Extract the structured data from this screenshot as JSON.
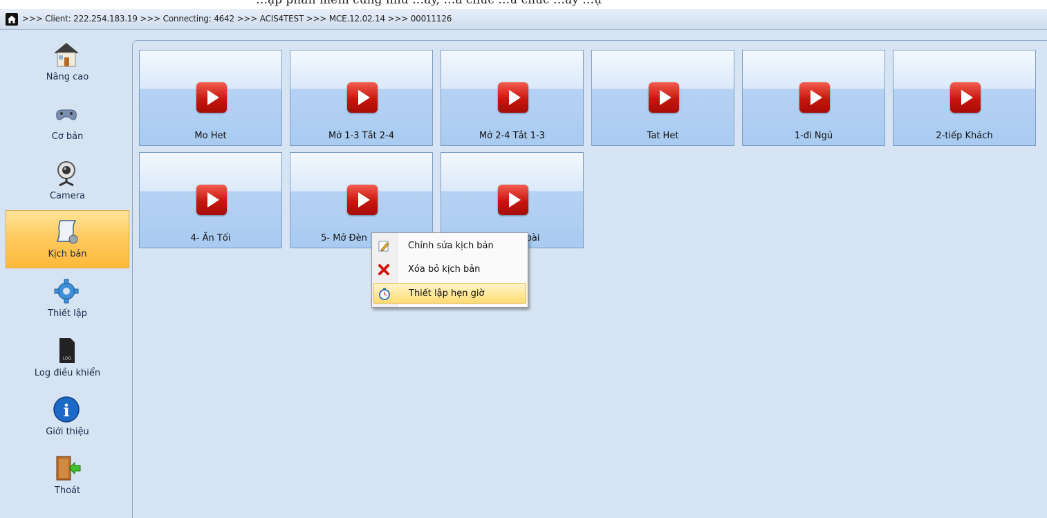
{
  "top_strip": {
    "text": "…ập phần mềm cũng như …ay, …à chức …ử chức …ày …ụ"
  },
  "title_bar": {
    "text": ">>> Client: 222.254.183.19 >>> Connecting: 4642 >>> ACIS4TEST >>> MCE.12.02.14 >>> 00011126"
  },
  "sidebar": {
    "items": [
      {
        "label": "Nâng cao",
        "icon": "house-icon"
      },
      {
        "label": "Cơ bản",
        "icon": "gamepad-icon"
      },
      {
        "label": "Camera",
        "icon": "webcam-icon"
      },
      {
        "label": "Kịch bản",
        "icon": "script-scroll-icon",
        "active": true
      },
      {
        "label": "Thiết lập",
        "icon": "gear-icon"
      },
      {
        "label": "Log điều khiển",
        "icon": "log-file-icon"
      },
      {
        "label": "Giới thiệu",
        "icon": "info-icon"
      },
      {
        "label": "Thoát",
        "icon": "exit-door-icon"
      }
    ]
  },
  "scenes": [
    {
      "label": "Mo Het"
    },
    {
      "label": "Mở 1-3 Tắt 2-4"
    },
    {
      "label": "Mở 2-4 Tắt 1-3"
    },
    {
      "label": "Tat Het"
    },
    {
      "label": "1-đi Ngủ"
    },
    {
      "label": "2-tiếp Khách"
    },
    {
      "label": "4- Ăn Tối"
    },
    {
      "label": "5- Mở Đèn"
    },
    {
      "label": "bài"
    }
  ],
  "context_menu": {
    "items": [
      {
        "label": "Chỉnh sửa kịch bản",
        "icon": "edit-pencil-icon"
      },
      {
        "label": "Xóa bỏ kịch bản",
        "icon": "delete-x-icon"
      },
      {
        "label": "Thiết lập hẹn giờ",
        "icon": "stopwatch-icon",
        "highlighted": true
      }
    ]
  },
  "colors": {
    "accent": "#ffc24d",
    "play": "#d21a10",
    "tile": "#b5d2f3"
  }
}
